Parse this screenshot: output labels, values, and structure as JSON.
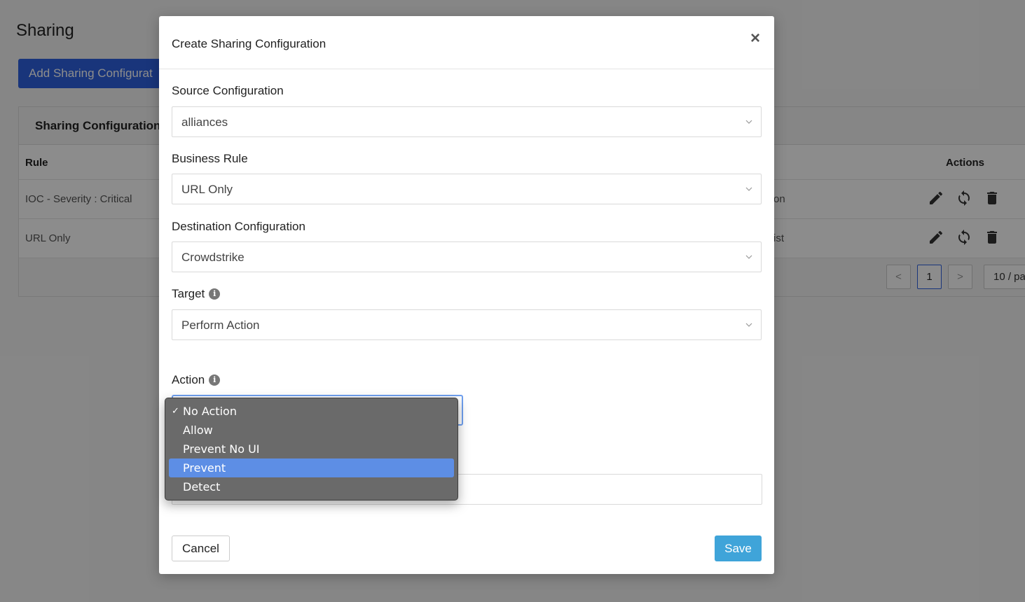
{
  "page": {
    "title": "Sharing",
    "add_button": "Add Sharing Configurat"
  },
  "panel": {
    "header": "Sharing Configuration",
    "columns": {
      "rule": "Rule",
      "actions": "Actions"
    },
    "rows": [
      {
        "rule": "IOC - Severity : Critical",
        "tail": "on"
      },
      {
        "rule": "URL Only",
        "tail": "ist"
      }
    ],
    "pagination": {
      "prev": "<",
      "page": "1",
      "next": ">",
      "page_size": "10 / pa"
    }
  },
  "modal": {
    "title": "Create Sharing Configuration",
    "close": "×",
    "fields": {
      "source": {
        "label": "Source Configuration",
        "value": "alliances"
      },
      "business_rule": {
        "label": "Business Rule",
        "value": "URL Only"
      },
      "destination": {
        "label": "Destination Configuration",
        "value": "Crowdstrike"
      },
      "target": {
        "label": "Target",
        "value": "Perform Action"
      },
      "action": {
        "label": "Action"
      }
    },
    "cancel": "Cancel",
    "save": "Save"
  },
  "dropdown": {
    "check": "✓",
    "options": [
      "No Action",
      "Allow",
      "Prevent No UI",
      "Prevent",
      "Detect"
    ],
    "selected": "No Action",
    "highlighted": "Prevent"
  },
  "colors": {
    "primary": "#2f62e0",
    "save": "#3fa4d9",
    "highlight": "#5d8ee5"
  },
  "icons": [
    "edit-icon",
    "sync-icon",
    "trash-icon",
    "info-icon",
    "chevron-down-icon",
    "close-icon",
    "check-icon"
  ]
}
